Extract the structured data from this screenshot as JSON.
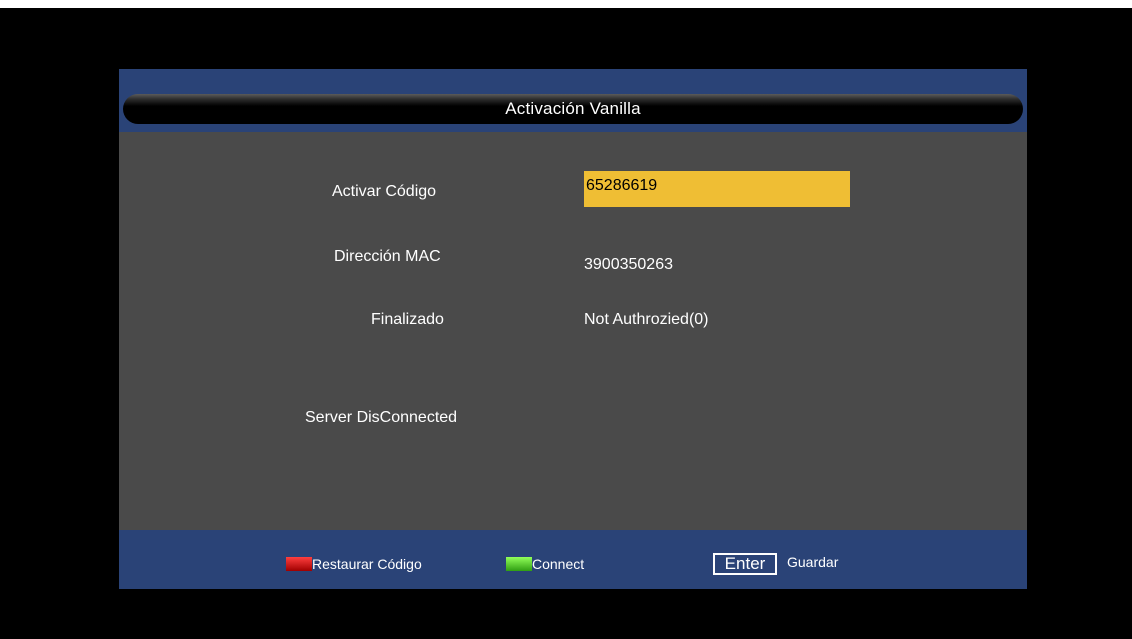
{
  "dialog": {
    "title": "Activación Vanilla"
  },
  "fields": {
    "code_label": "Activar Código",
    "code_value": "65286619",
    "mac_label": "Dirección MAC",
    "mac_value": "3900350263",
    "status_label": "Finalizado",
    "status_value": "Not Authrozied(0)",
    "server_status": "Server DisConnected"
  },
  "footer": {
    "red_label": "Restaurar Código",
    "green_label": "Connect",
    "enter_key": "Enter",
    "enter_label": "Guardar"
  },
  "colors": {
    "highlight": "#efbe34",
    "panel": "#4a4a4a",
    "band": "#2a4377",
    "red_key": "#d40000",
    "green_key": "#5ad22a"
  },
  "icons": {
    "red": "red-color-key-icon",
    "green": "green-color-key-icon"
  }
}
